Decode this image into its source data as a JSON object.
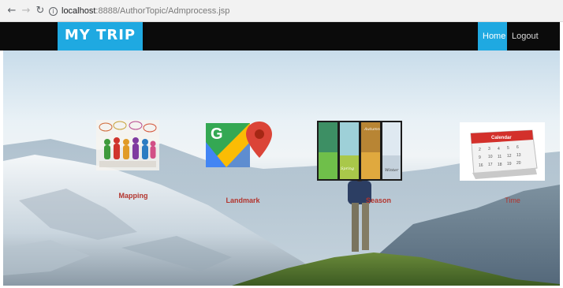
{
  "browser": {
    "back_icon": "arrow-left-icon",
    "forward_icon": "arrow-right-icon",
    "reload_icon": "reload-icon",
    "info_icon": "info-icon",
    "url_host": "localhost",
    "url_path": ":8888/AuthorTopic/Admprocess.jsp"
  },
  "navbar": {
    "brand": "MY TRIP",
    "items": [
      {
        "label": "Home",
        "active": true
      },
      {
        "label": "Logout",
        "active": false
      }
    ]
  },
  "tiles": [
    {
      "label": "Mapping",
      "icon": "people-speech-icon"
    },
    {
      "label": "Landmark",
      "icon": "google-maps-icon"
    },
    {
      "label": "Season",
      "icon": "seasons-icon"
    },
    {
      "label": "Time",
      "icon": "calendar-icon"
    }
  ],
  "colors": {
    "accent": "#1fa9e1",
    "navbar": "#0b0b0b",
    "tile_label": "#b3352e"
  }
}
